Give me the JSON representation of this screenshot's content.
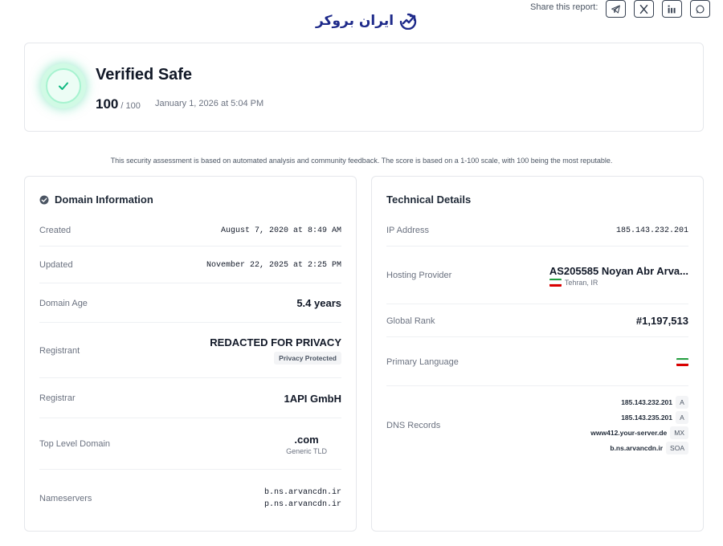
{
  "header": {
    "logo_text": "ایران بروکر",
    "share_label": "Share this report:",
    "share_buttons": [
      {
        "icon": "telegram-icon"
      },
      {
        "icon": "x-icon"
      },
      {
        "icon": "linkedin-icon"
      },
      {
        "icon": "whatsapp-icon"
      }
    ]
  },
  "verdict": {
    "title": "Verified Safe",
    "score": "100",
    "score_max": "/ 100",
    "date": "January 1, 2026 at 5:04 PM",
    "icon": "check-icon",
    "accent_color": "#10b981"
  },
  "disclaimer": "This security assessment is based on automated analysis and community feedback. The score is based on a 1-100 scale, with 100 being the most reputable.",
  "domain_info": {
    "title": "Domain Information",
    "created_label": "Created",
    "created_value": "August 7, 2020 at 8:49 AM",
    "updated_label": "Updated",
    "updated_value": "November 22, 2025 at 2:25 PM",
    "age_label": "Domain Age",
    "age_value": "5.4 years",
    "registrant_label": "Registrant",
    "registrant_value": "REDACTED FOR PRIVACY",
    "registrant_badge": "Privacy Protected",
    "registrar_label": "Registrar",
    "registrar_value": "1API GmbH",
    "tld_label": "Top Level Domain",
    "tld_value": ".com",
    "tld_sub": "Generic TLD",
    "ns_label": "Nameservers",
    "nameservers": [
      "b.ns.arvancdn.ir",
      "p.ns.arvancdn.ir"
    ]
  },
  "technical": {
    "title": "Technical Details",
    "ip_label": "IP Address",
    "ip_value": "185.143.232.201",
    "hosting_label": "Hosting Provider",
    "hosting_value": "AS205585 Noyan Abr Arva...",
    "hosting_location": "Tehran, IR",
    "rank_label": "Global Rank",
    "rank_value": "#1,197,513",
    "language_label": "Primary Language",
    "dns_label": "DNS Records",
    "dns_records": [
      {
        "value": "185.143.232.201",
        "type": "A"
      },
      {
        "value": "185.143.235.201",
        "type": "A"
      },
      {
        "value": "www412.your-server.de",
        "type": "MX"
      },
      {
        "value": "b.ns.arvancdn.ir",
        "type": "SOA"
      }
    ]
  }
}
